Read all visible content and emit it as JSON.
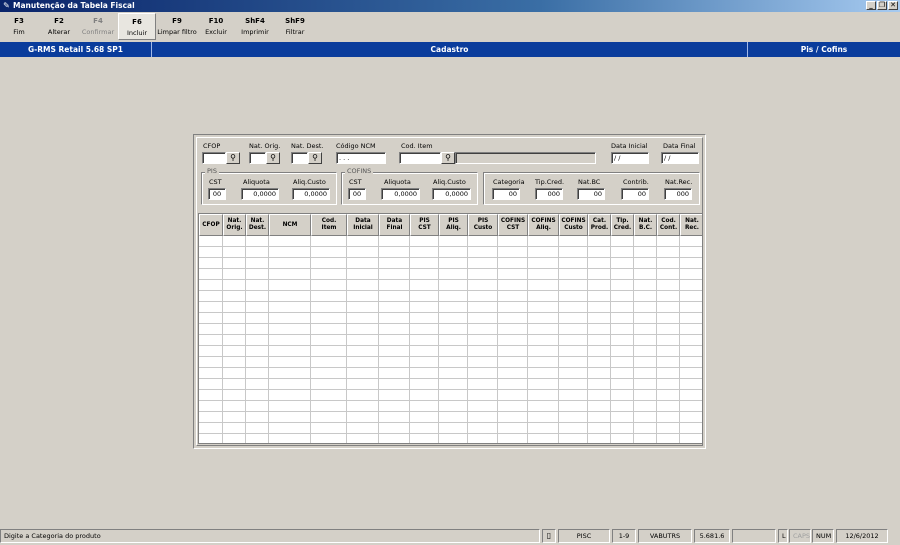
{
  "window": {
    "title": "Manutenção da Tabela Fiscal",
    "min": "_",
    "restore": "❐",
    "close": "✕"
  },
  "toolbar": [
    {
      "key": "F3",
      "label": "Fim",
      "state": "normal"
    },
    {
      "key": "F2",
      "label": "Alterar",
      "state": "normal"
    },
    {
      "key": "F4",
      "label": "Confirmar",
      "state": "disabled"
    },
    {
      "key": "F6",
      "label": "Incluir",
      "state": "active"
    },
    {
      "key": "F9",
      "label": "Limpar filtro",
      "state": "normal"
    },
    {
      "key": "F10",
      "label": "Excluir",
      "state": "normal"
    },
    {
      "key": "ShF4",
      "label": "Imprimir",
      "state": "normal"
    },
    {
      "key": "ShF9",
      "label": "Filtrar",
      "state": "normal"
    }
  ],
  "band": {
    "version": "G-RMS Retail 5.68 SP1",
    "section": "Cadastro",
    "module": "Pis / Cofins"
  },
  "filters": {
    "cfop_label": "CFOP",
    "cfop_value": "",
    "nat_orig_label": "Nat. Orig.",
    "nat_orig_value": "",
    "nat_dest_label": "Nat. Dest.",
    "nat_dest_value": "",
    "ncm_label": "Código NCM",
    "ncm_value": ". . .",
    "item_label": "Cod. Item",
    "item_value": "",
    "item_desc": "",
    "date_start_label": "Data Inicial",
    "date_start_value": "/ /",
    "date_end_label": "Data Final",
    "date_end_value": "/ /",
    "search_icon": "binoculars-icon"
  },
  "pis": {
    "title": "PIS",
    "cst_label": "CST",
    "cst_value": "00",
    "aliq_label": "Aliquota",
    "aliq_value": "0,0000",
    "custo_label": "Aliq.Custo",
    "custo_value": "0,0000"
  },
  "cofins": {
    "title": "COFINS",
    "cst_label": "CST",
    "cst_value": "00",
    "aliq_label": "Aliquota",
    "aliq_value": "0,0000",
    "custo_label": "Aliq.Custo",
    "custo_value": "0,0000"
  },
  "other": {
    "categoria_label": "Categoria",
    "categoria_value": "00",
    "tipcred_label": "Tip.Cred.",
    "tipcred_value": "000",
    "natbc_label": "Nat.BC",
    "natbc_value": "00",
    "contrib_label": "Contrib.",
    "contrib_value": "00",
    "natrec_label": "Nat.Rec.",
    "natrec_value": "000"
  },
  "grid": {
    "columns": [
      "CFOP",
      "Nat.\nOrig.",
      "Nat.\nDest.",
      "NCM",
      "Cod.\nItem",
      "Data\nInicial",
      "Data\nFinal",
      "PIS\nCST",
      "PIS\nAliq.",
      "PIS\nCusto",
      "COFINS\nCST",
      "COFINS\nAliq.",
      "COFINS\nCusto",
      "Cat.\nProd.",
      "Tip.\nCred.",
      "Nat.\nB.C.",
      "Cod.\nCont.",
      "Nat.\nRec."
    ],
    "rows": []
  },
  "status": {
    "message": "Digite a Categoria do produto",
    "p1": "PISC",
    "p2": "1-9",
    "p3": "VABUTRS",
    "p4": "5.681.6",
    "p5": "",
    "p6": "L",
    "p7": "CAPS",
    "p8": "NUM",
    "p9": "12/6/2012"
  }
}
